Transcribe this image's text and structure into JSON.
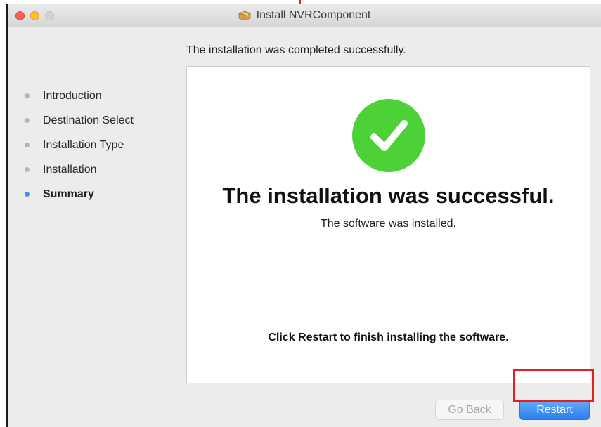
{
  "window": {
    "title": "Install NVRComponent",
    "title_icon": "package-icon"
  },
  "header": {
    "text": "The installation was completed successfully."
  },
  "sidebar": {
    "steps": [
      {
        "label": "Introduction",
        "current": false
      },
      {
        "label": "Destination Select",
        "current": false
      },
      {
        "label": "Installation Type",
        "current": false
      },
      {
        "label": "Installation",
        "current": false
      },
      {
        "label": "Summary",
        "current": true
      }
    ]
  },
  "content": {
    "icon": "success-check-icon",
    "title": "The installation was successful.",
    "subtitle": "The software was installed.",
    "note": "Click Restart to finish installing the software."
  },
  "buttons": {
    "back_label": "Go Back",
    "back_enabled": false,
    "restart_label": "Restart"
  },
  "colors": {
    "accent": "#2a7ff0",
    "success": "#4cd137",
    "highlight": "#e0201d"
  }
}
